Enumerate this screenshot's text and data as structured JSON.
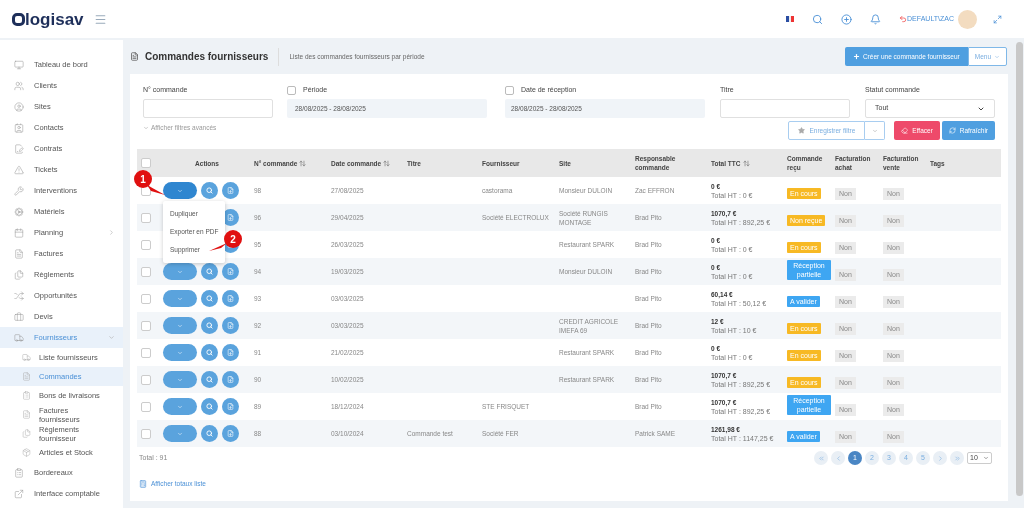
{
  "header": {
    "logo": "logisav",
    "user": "DEFAULT\\ZAC"
  },
  "sidebar": {
    "items": [
      {
        "label": "Tableau de bord",
        "selected": false
      },
      {
        "label": "Clients",
        "selected": false
      },
      {
        "label": "Sites",
        "selected": false
      },
      {
        "label": "Contacts",
        "selected": false
      },
      {
        "label": "Contrats",
        "selected": false
      },
      {
        "label": "Tickets",
        "selected": false
      },
      {
        "label": "Interventions",
        "selected": false
      },
      {
        "label": "Matériels",
        "selected": false
      },
      {
        "label": "Planning",
        "selected": false,
        "expanded": false
      },
      {
        "label": "Factures",
        "selected": false
      },
      {
        "label": "Règlements",
        "selected": false
      },
      {
        "label": "Opportunités",
        "selected": false
      },
      {
        "label": "Devis",
        "selected": false
      },
      {
        "label": "Fournisseurs",
        "selected": true,
        "expanded": true,
        "children": [
          {
            "label": "Liste fournisseurs",
            "selected": false
          },
          {
            "label": "Commandes",
            "selected": true
          },
          {
            "label": "Bons de livraisons",
            "selected": false
          },
          {
            "label": "Factures fournisseurs",
            "selected": false
          },
          {
            "label": "Règlements fournisseur",
            "selected": false
          },
          {
            "label": "Articles et Stock",
            "selected": false
          }
        ]
      },
      {
        "label": "Bordereaux",
        "selected": false
      },
      {
        "label": "Interface comptable",
        "selected": false
      }
    ]
  },
  "page": {
    "title": "Commandes fournisseurs",
    "subtitle": "Liste des commandes fournisseurs par période",
    "create_button": "Créer une commande fournisseur",
    "menu_button": "Menu"
  },
  "filters": {
    "order_number": {
      "label": "N° commande"
    },
    "period": {
      "label": "Période",
      "checked": false,
      "value": "28/08/2025 - 28/08/2025"
    },
    "reception": {
      "label": "Date de réception",
      "checked": false,
      "value": "28/08/2025 - 28/08/2025"
    },
    "title": {
      "label": "Titre"
    },
    "status": {
      "label": "Statut commande",
      "value": "Tout"
    },
    "advanced_link": "Afficher filtres avancés",
    "save_filter": "Enregistrer filtre",
    "clear": "Effacer",
    "refresh": "Rafraîchir"
  },
  "table": {
    "all_checked": false,
    "columns": [
      {
        "label": "Actions",
        "sortable": false
      },
      {
        "label": "N° commande",
        "sortable": true
      },
      {
        "label": "Date commande",
        "sortable": true
      },
      {
        "label": "Titre",
        "sortable": false
      },
      {
        "label": "Fournisseur",
        "sortable": false
      },
      {
        "label": "Site",
        "sortable": false
      },
      {
        "label": "Responsable commande",
        "sortable": false
      },
      {
        "label": "Total TTC",
        "sortable": true
      },
      {
        "label": "Commande reçu",
        "sortable": false
      },
      {
        "label": "Facturation achat",
        "sortable": false
      },
      {
        "label": "Facturation vente",
        "sortable": false
      },
      {
        "label": "Tags",
        "sortable": false
      }
    ],
    "rows": [
      {
        "checked": false,
        "menu_open": true,
        "number": "98",
        "date": "27/08/2025",
        "supplier": "castorama",
        "site": "Monsieur DULOIN",
        "manager": "Zac EFFRON",
        "total_ttc": "0 €",
        "total_ht": "Total HT : 0 €",
        "status": {
          "label": "En cours",
          "color": "#f7b924"
        },
        "purchase": "Non",
        "sale": "Non"
      },
      {
        "checked": false,
        "number": "96",
        "date": "29/04/2025",
        "supplier": "Société ELECTROLUX",
        "site": "Société RUNGIS MONTAGE",
        "manager": "Brad Pito",
        "total_ttc": "1070,7 €",
        "total_ht": "Total HT : 892,25 €",
        "status": {
          "label": "Non reçue",
          "color": "#f7b924"
        },
        "purchase": "Non",
        "sale": "Non"
      },
      {
        "checked": false,
        "number": "95",
        "date": "26/03/2025",
        "site": "Restaurant SPARK",
        "manager": "Brad Pito",
        "total_ttc": "0 €",
        "total_ht": "Total HT : 0 €",
        "status": {
          "label": "En cours",
          "color": "#f7b924"
        },
        "purchase": "Non",
        "sale": "Non"
      },
      {
        "checked": false,
        "number": "94",
        "date": "19/03/2025",
        "site": "Monsieur DULOIN",
        "manager": "Brad Pito",
        "total_ttc": "0 €",
        "total_ht": "Total HT : 0 €",
        "status": {
          "label": "Réception partielle",
          "color": "#3ea6f2"
        },
        "purchase": "Non",
        "sale": "Non"
      },
      {
        "checked": false,
        "number": "93",
        "date": "03/03/2025",
        "manager": "Brad Pito",
        "total_ttc": "60,14 €",
        "total_ht": "Total HT : 50,12 €",
        "status": {
          "label": "A valider",
          "color": "#3ea6f2"
        },
        "purchase": "Non",
        "sale": "Non"
      },
      {
        "checked": false,
        "number": "92",
        "date": "03/03/2025",
        "site": "CREDIT AGRICOLE IMEFA 69",
        "manager": "Brad Pito",
        "total_ttc": "12 €",
        "total_ht": "Total HT : 10 €",
        "status": {
          "label": "En cours",
          "color": "#f7b924"
        },
        "purchase": "Non",
        "sale": "Non"
      },
      {
        "checked": false,
        "number": "91",
        "date": "21/02/2025",
        "site": "Restaurant SPARK",
        "manager": "Brad Pito",
        "total_ttc": "0 €",
        "total_ht": "Total HT : 0 €",
        "status": {
          "label": "En cours",
          "color": "#f7b924"
        },
        "purchase": "Non",
        "sale": "Non"
      },
      {
        "checked": false,
        "number": "90",
        "date": "10/02/2025",
        "site": "Restaurant SPARK",
        "manager": "Brad Pito",
        "total_ttc": "1070,7 €",
        "total_ht": "Total HT : 892,25 €",
        "status": {
          "label": "En cours",
          "color": "#f7b924"
        },
        "purchase": "Non",
        "sale": "Non"
      },
      {
        "checked": false,
        "number": "89",
        "date": "18/12/2024",
        "supplier": "STE FRISQUET",
        "manager": "Brad Pito",
        "total_ttc": "1070,7 €",
        "total_ht": "Total HT : 892,25 €",
        "status": {
          "label": "Réception partielle",
          "color": "#3ea6f2"
        },
        "purchase": "Non",
        "sale": "Non"
      },
      {
        "checked": false,
        "number": "88",
        "date": "03/10/2024",
        "title": "Commande test",
        "supplier": "Société FER",
        "manager": "Patrick SAME",
        "total_ttc": "1261,98 €",
        "total_ht": "Total HT : 1147,25 €",
        "status": {
          "label": "A valider",
          "color": "#3ea6f2"
        },
        "purchase": "Non",
        "sale": "Non"
      }
    ],
    "row_menu": [
      "Dupliquer",
      "Exporter en PDF",
      "Supprimer"
    ],
    "total": "Total : 91",
    "show_totals": "Afficher totaux liste"
  },
  "pagination": {
    "pages": [
      {
        "label": "1",
        "selected": true
      },
      {
        "label": "2",
        "selected": false
      },
      {
        "label": "3",
        "selected": false
      },
      {
        "label": "4",
        "selected": false
      },
      {
        "label": "5",
        "selected": false
      }
    ],
    "page_size": "10"
  },
  "callouts": [
    "1",
    "2"
  ]
}
